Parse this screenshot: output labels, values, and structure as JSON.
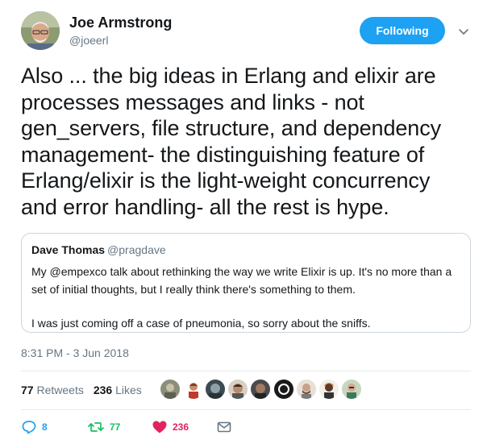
{
  "author": {
    "name": "Joe Armstrong",
    "handle": "@joeerl"
  },
  "follow_button": {
    "label": "Following",
    "color": "#1da1f2"
  },
  "tweet": {
    "lines": [
      "Also ... the big ideas in Erlang and elixir are",
      "processes messages and links - not",
      "gen_servers, file structure, and dependency",
      "management- the distinguishing feature of",
      "Erlang/elixir is the light-weight concurrency",
      "and error handling- all the rest is hype."
    ],
    "timestamp": "8:31 PM - 3 Jun 2018"
  },
  "quoted_tweet": {
    "name": "Dave Thomas",
    "handle": "@pragdave",
    "lines": [
      "My @empexco talk about rethinking the way we write Elixir is up. It's no more than a",
      "set of initial thoughts, but I really think there's something to them."
    ],
    "lines_2": [
      "I was just coming off a case of pneumonia, so sorry about the sniffs."
    ]
  },
  "stats": {
    "retweets_count": "77",
    "retweets_label": "Retweets",
    "likes_count": "236",
    "likes_label": "Likes"
  },
  "liker_avatars": [
    "avatar-1",
    "avatar-2",
    "avatar-3",
    "avatar-4",
    "avatar-5",
    "avatar-6",
    "avatar-7",
    "avatar-8",
    "avatar-9",
    "avatar-10"
  ],
  "actions": {
    "reply_count": "8",
    "retweet_count": "77",
    "like_count": "236",
    "reply_icon": "reply-icon",
    "retweet_icon": "retweet-icon",
    "like_icon": "heart-icon",
    "dm_icon": "envelope-icon",
    "reply_color": "#1da1f2",
    "retweet_color": "#17bf63",
    "like_color": "#e0245e"
  },
  "colors": {
    "text": "#14171a",
    "secondary": "#657786",
    "border": "#ccd6dd",
    "divider": "#e6ecf0"
  }
}
